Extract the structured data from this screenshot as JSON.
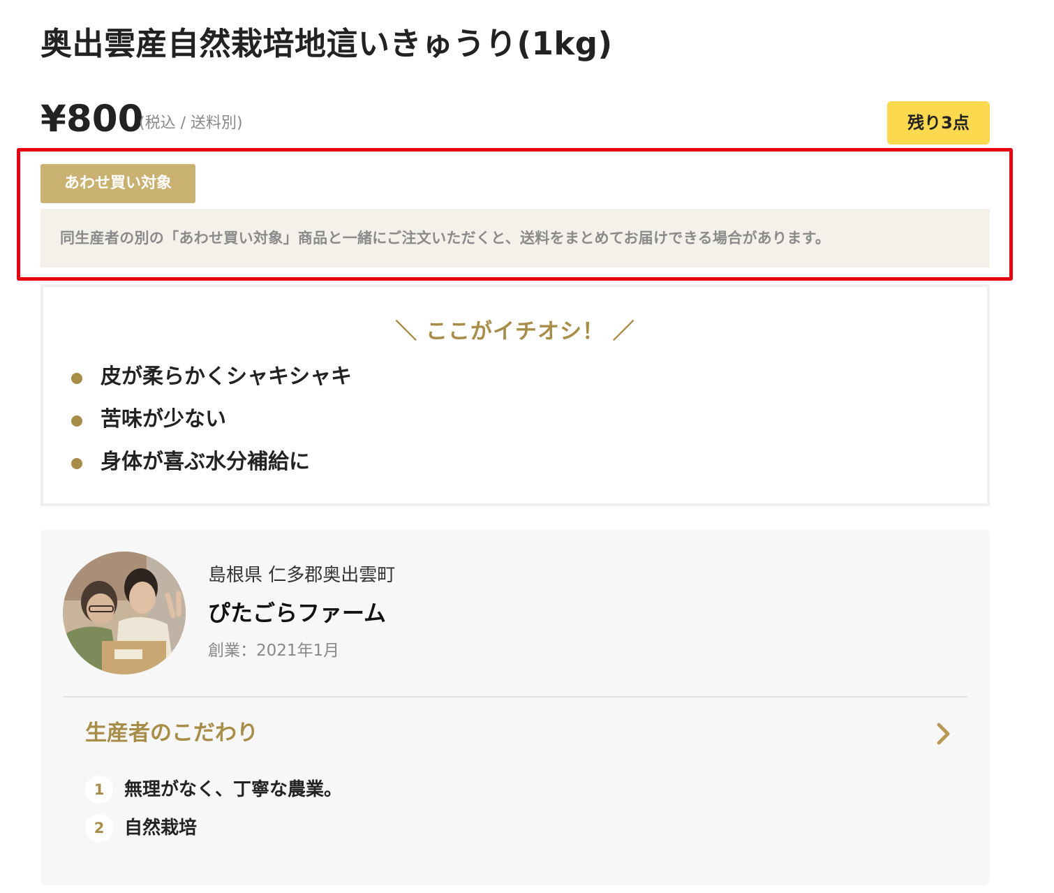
{
  "product": {
    "title": "奥出雲産自然栽培地這いきゅうり(1kg)",
    "price": "¥800",
    "price_note": "(税込 / 送料別)",
    "stock_badge": "残り3点"
  },
  "bundle": {
    "badge": "あわせ買い対象",
    "note": "同生産者の別の「あわせ買い対象」商品と一緒にご注文いただくと、送料をまとめてお届けできる場合があります。"
  },
  "recommend": {
    "heading": "＼ ここがイチオシ！ ／",
    "items": [
      "皮が柔らかくシャキシャキ",
      "苦味が少ない",
      "身体が喜ぶ水分補給に"
    ]
  },
  "producer": {
    "location": "島根県 仁多郡奥出雲町",
    "name": "ぴたごらファーム",
    "founded": "創業：2021年1月",
    "commitment_title": "生産者のこだわり",
    "commitments": [
      {
        "number": "1",
        "text": "無理がなく、丁寧な農業。"
      },
      {
        "number": "2",
        "text": "自然栽培"
      }
    ]
  },
  "colors": {
    "accent_gold": "#a88d49",
    "badge_gold": "#c9b271",
    "stock_yellow": "#fcd94f",
    "highlight_red": "#e60012"
  }
}
